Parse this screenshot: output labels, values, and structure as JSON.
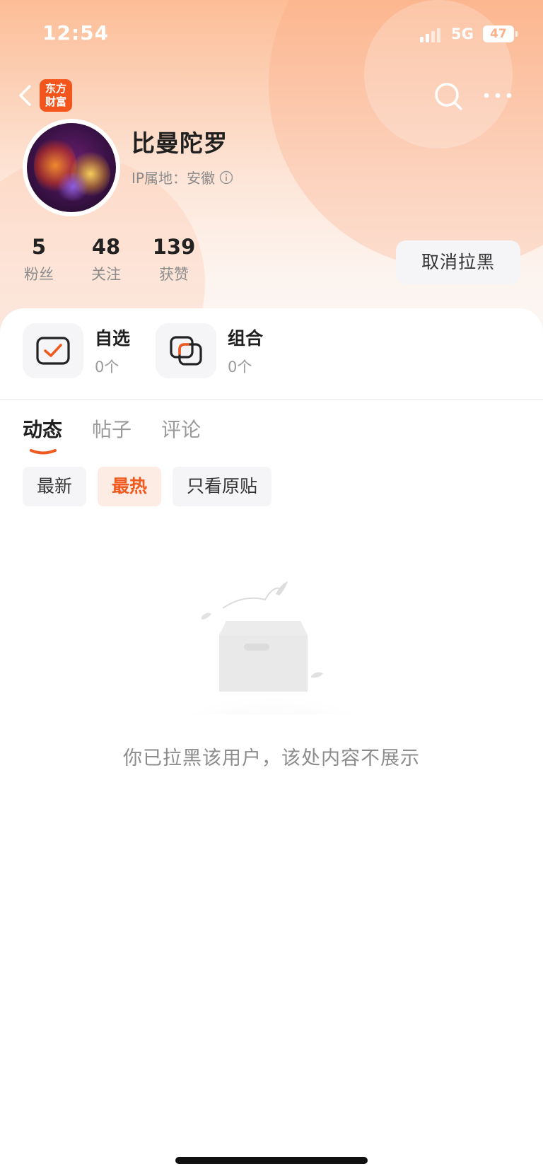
{
  "status_bar": {
    "time": "12:54",
    "network": "5G",
    "battery": "47"
  },
  "nav": {
    "logo_line1": "东方",
    "logo_line2": "财富",
    "brand_color": "#f2561d"
  },
  "profile": {
    "name": "比曼陀罗",
    "ip_location": "IP属地：安徽",
    "stats": [
      {
        "value": "5",
        "label": "粉丝"
      },
      {
        "value": "48",
        "label": "关注"
      },
      {
        "value": "139",
        "label": "获赞"
      }
    ],
    "unblock_label": "取消拉黑"
  },
  "assets": [
    {
      "title": "自选",
      "count": "0个",
      "icon": "watchlist-check-icon"
    },
    {
      "title": "组合",
      "count": "0个",
      "icon": "portfolio-icon"
    }
  ],
  "tabs": [
    {
      "label": "动态",
      "active": true
    },
    {
      "label": "帖子",
      "active": false
    },
    {
      "label": "评论",
      "active": false
    }
  ],
  "filters": [
    {
      "label": "最新",
      "active": false
    },
    {
      "label": "最热",
      "active": true
    },
    {
      "label": "只看原贴",
      "active": false
    }
  ],
  "empty_state": {
    "message": "你已拉黑该用户，该处内容不展示",
    "icon": "empty-box-icon"
  },
  "colors": {
    "accent": "#f05a1f",
    "header_gradient_top": "#fdbd96"
  }
}
